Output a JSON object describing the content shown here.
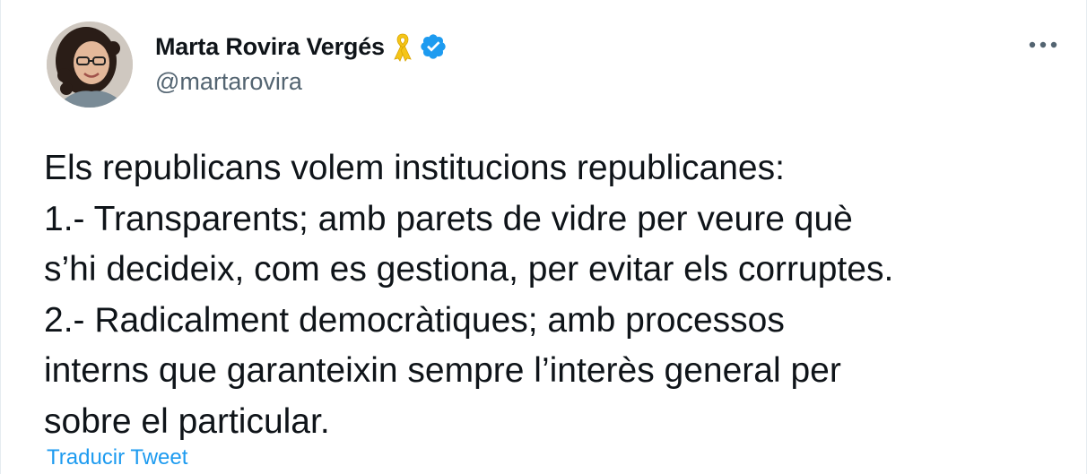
{
  "author": {
    "display_name": "Marta Rovira Vergés",
    "handle": "@martarovira",
    "badges": [
      "yellow-ribbon-icon",
      "verified-badge-icon"
    ]
  },
  "actions": {
    "more_icon": "more-horizontal-icon"
  },
  "tweet": {
    "lines": [
      "Els republicans volem institucions republicanes:",
      "1.- Transparents; amb parets de vidre per veure què",
      "s’hi decideix, com es gestiona, per evitar els corruptes.",
      "2.- Radicalment democràtiques; amb processos",
      "interns que garanteixin sempre l’interès general per",
      "sobre el particular."
    ],
    "translate_label": "Traducir Tweet"
  },
  "colors": {
    "text_primary": "#0f1419",
    "text_secondary": "#536471",
    "link": "#1d9bf0",
    "verified": "#1d9bf0",
    "ribbon": "#f5c518"
  }
}
